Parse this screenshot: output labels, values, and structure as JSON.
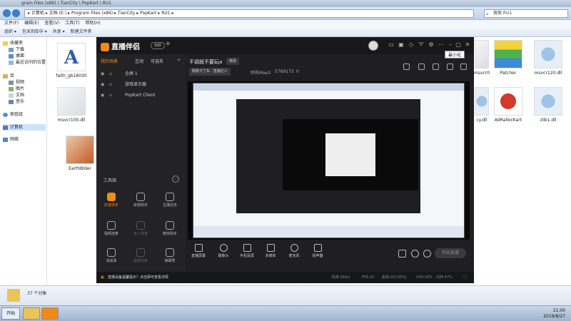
{
  "explorer": {
    "title": "gram Files (x86) \\ TianCity \\ PopKart \\ RU1",
    "breadcrumb": [
      "计算机",
      "文档 (E:)",
      "Program Files (x86)",
      "TianCity",
      "PopKart",
      "RU1"
    ],
    "breadcrumb_text": "▸ 计算机 ▸ 文档 (E:) ▸ Program Files (x86) ▸ TianCity ▸ PopKart ▸ RU1 ▸",
    "search_placeholder": "搜索 RU1",
    "menu": [
      "文件(F)",
      "编辑(E)",
      "查看(V)",
      "工具(T)",
      "帮助(H)"
    ],
    "toolbar": [
      "组织 ▾",
      "包含到库中 ▾",
      "共享 ▾",
      "新建文件夹"
    ],
    "nav": {
      "favorites": "收藏夹",
      "downloads": "下载",
      "desktop": "桌面",
      "recent": "最近访问的位置",
      "libraries": "库",
      "videos": "视频",
      "pictures": "图片",
      "documents": "文档",
      "music": "音乐",
      "homegroup": "家庭组",
      "computer": "计算机",
      "network": "网络"
    },
    "files_left": [
      {
        "name": "faith_gb18030"
      },
      {
        "name": "msvcr100.dll"
      },
      {
        "name": "EarthBlder"
      }
    ],
    "files_right": [
      {
        "name": "msvcr0"
      },
      {
        "name": "Patcher"
      },
      {
        "name": "msvcr120.dll"
      },
      {
        "name": "cy.dll"
      },
      {
        "name": "AdRallocKart"
      },
      {
        "name": "zlib1.dll"
      }
    ],
    "status_count": "37 个对象"
  },
  "taskbar": {
    "start_label": "开始",
    "time": "21:00",
    "date": "2019/8/27"
  },
  "app": {
    "brand": "直播伴侣",
    "version_badge": "旗舰",
    "tooltip": "最小化",
    "source_tabs": [
      "我的场景",
      "互动",
      "可选名"
    ],
    "sources": [
      {
        "name": "全屏 1"
      },
      {
        "name": "游戏显示器"
      },
      {
        "name": "PopKart Client"
      }
    ],
    "tools_title": "工具箱",
    "tools": [
      {
        "label": "抖音助手"
      },
      {
        "label": "房管助手"
      },
      {
        "label": "主播任务"
      },
      {
        "label": "视频连麦"
      },
      {
        "label": "多人连麦"
      },
      {
        "label": "榜单助手"
      },
      {
        "label": "谈话事"
      },
      {
        "label": "虚拟形象"
      },
      {
        "label": "弹幕秀"
      }
    ],
    "scene_title": "不调就不要玩a",
    "modify_label": "修改",
    "category_label": "跑跑卡丁车 · 直播达人",
    "anchor": "阿布Mae3",
    "room_id": "5769173",
    "likes": "0",
    "bottom_buttons": [
      {
        "label": "直播屏幕"
      },
      {
        "label": "摄像头"
      },
      {
        "label": "手机投屏"
      },
      {
        "label": "多媒体"
      },
      {
        "label": "麦克风"
      },
      {
        "label": "扬声器"
      }
    ],
    "start_live": "开始直播",
    "notice": "直播设备温馨提示？点击即可查看详情",
    "stats": [
      "码率:0kb/s",
      "FPS:23",
      "丢帧:0(0.00%)",
      "CPU:39%",
      "内存:47%"
    ]
  },
  "colors": {
    "accent": "#f08a18",
    "app_bg": "#1f1f22",
    "explorer_selection": "#cde3fb"
  }
}
